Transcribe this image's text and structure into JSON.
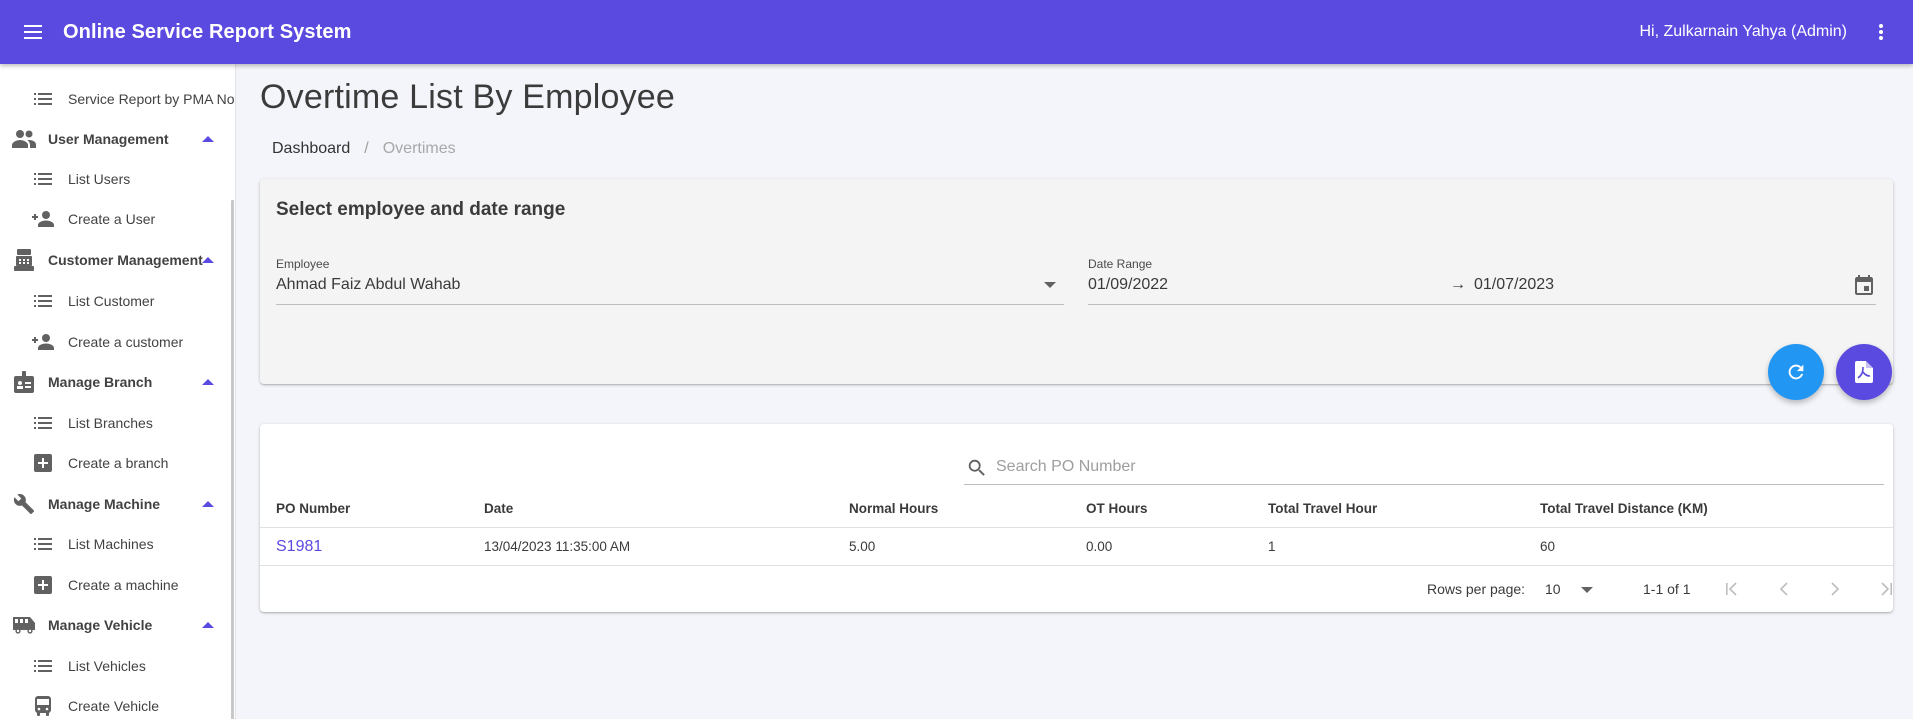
{
  "app": {
    "title": "Online Service Report System",
    "user_greeting": "Hi, Zulkarnain Yahya (Admin)",
    "colors": {
      "primary": "#5b4ae0",
      "refresh_fab": "#2196f3",
      "link": "#5b4ae0"
    }
  },
  "sidebar": {
    "items": [
      {
        "type": "child",
        "icon": "list-icon",
        "label": "Service Report by PMA No"
      },
      {
        "type": "group",
        "icon": "people-icon",
        "label": "User Management",
        "expanded": true
      },
      {
        "type": "child",
        "icon": "list-icon",
        "label": "List Users"
      },
      {
        "type": "child",
        "icon": "person-add-icon",
        "label": "Create a User"
      },
      {
        "type": "group",
        "icon": "fax-icon",
        "label": "Customer Management",
        "expanded": true
      },
      {
        "type": "child",
        "icon": "list-icon",
        "label": "List Customer"
      },
      {
        "type": "child",
        "icon": "person-add-icon",
        "label": "Create a customer"
      },
      {
        "type": "group",
        "icon": "badge-icon",
        "label": "Manage Branch",
        "expanded": true
      },
      {
        "type": "child",
        "icon": "list-icon",
        "label": "List Branches"
      },
      {
        "type": "child",
        "icon": "add-box-icon",
        "label": "Create a branch"
      },
      {
        "type": "group",
        "icon": "wrench-icon",
        "label": "Manage Machine",
        "expanded": true
      },
      {
        "type": "child",
        "icon": "list-icon",
        "label": "List Machines"
      },
      {
        "type": "child",
        "icon": "add-box-icon",
        "label": "Create a machine"
      },
      {
        "type": "group",
        "icon": "van-icon",
        "label": "Manage Vehicle",
        "expanded": true
      },
      {
        "type": "child",
        "icon": "list-icon",
        "label": "List Vehicles"
      },
      {
        "type": "child",
        "icon": "bus-icon",
        "label": "Create Vehicle"
      }
    ]
  },
  "page": {
    "title": "Overtime List By Employee",
    "breadcrumb": {
      "link": "Dashboard",
      "separator": "/",
      "current": "Overtimes"
    }
  },
  "filter": {
    "title": "Select employee and date range",
    "employee": {
      "label": "Employee",
      "value": "Ahmad Faiz Abdul Wahab"
    },
    "date_range": {
      "label": "Date Range",
      "start": "01/09/2022",
      "arrow": "→",
      "end": "01/07/2023"
    }
  },
  "actions": {
    "refresh": "refresh-icon",
    "export_pdf": "pdf-icon"
  },
  "table": {
    "search_placeholder": "Search PO Number",
    "search_value": "",
    "columns": [
      "PO Number",
      "Date",
      "Normal Hours",
      "OT Hours",
      "Total Travel Hour",
      "Total Travel Distance (KM)"
    ],
    "rows": [
      [
        "S1981",
        "13/04/2023 11:35:00 AM",
        "5.00",
        "0.00",
        "1",
        "60"
      ]
    ],
    "pagination": {
      "rows_per_page_label": "Rows per page:",
      "rows_per_page": "10",
      "range": "1-1 of 1"
    }
  }
}
